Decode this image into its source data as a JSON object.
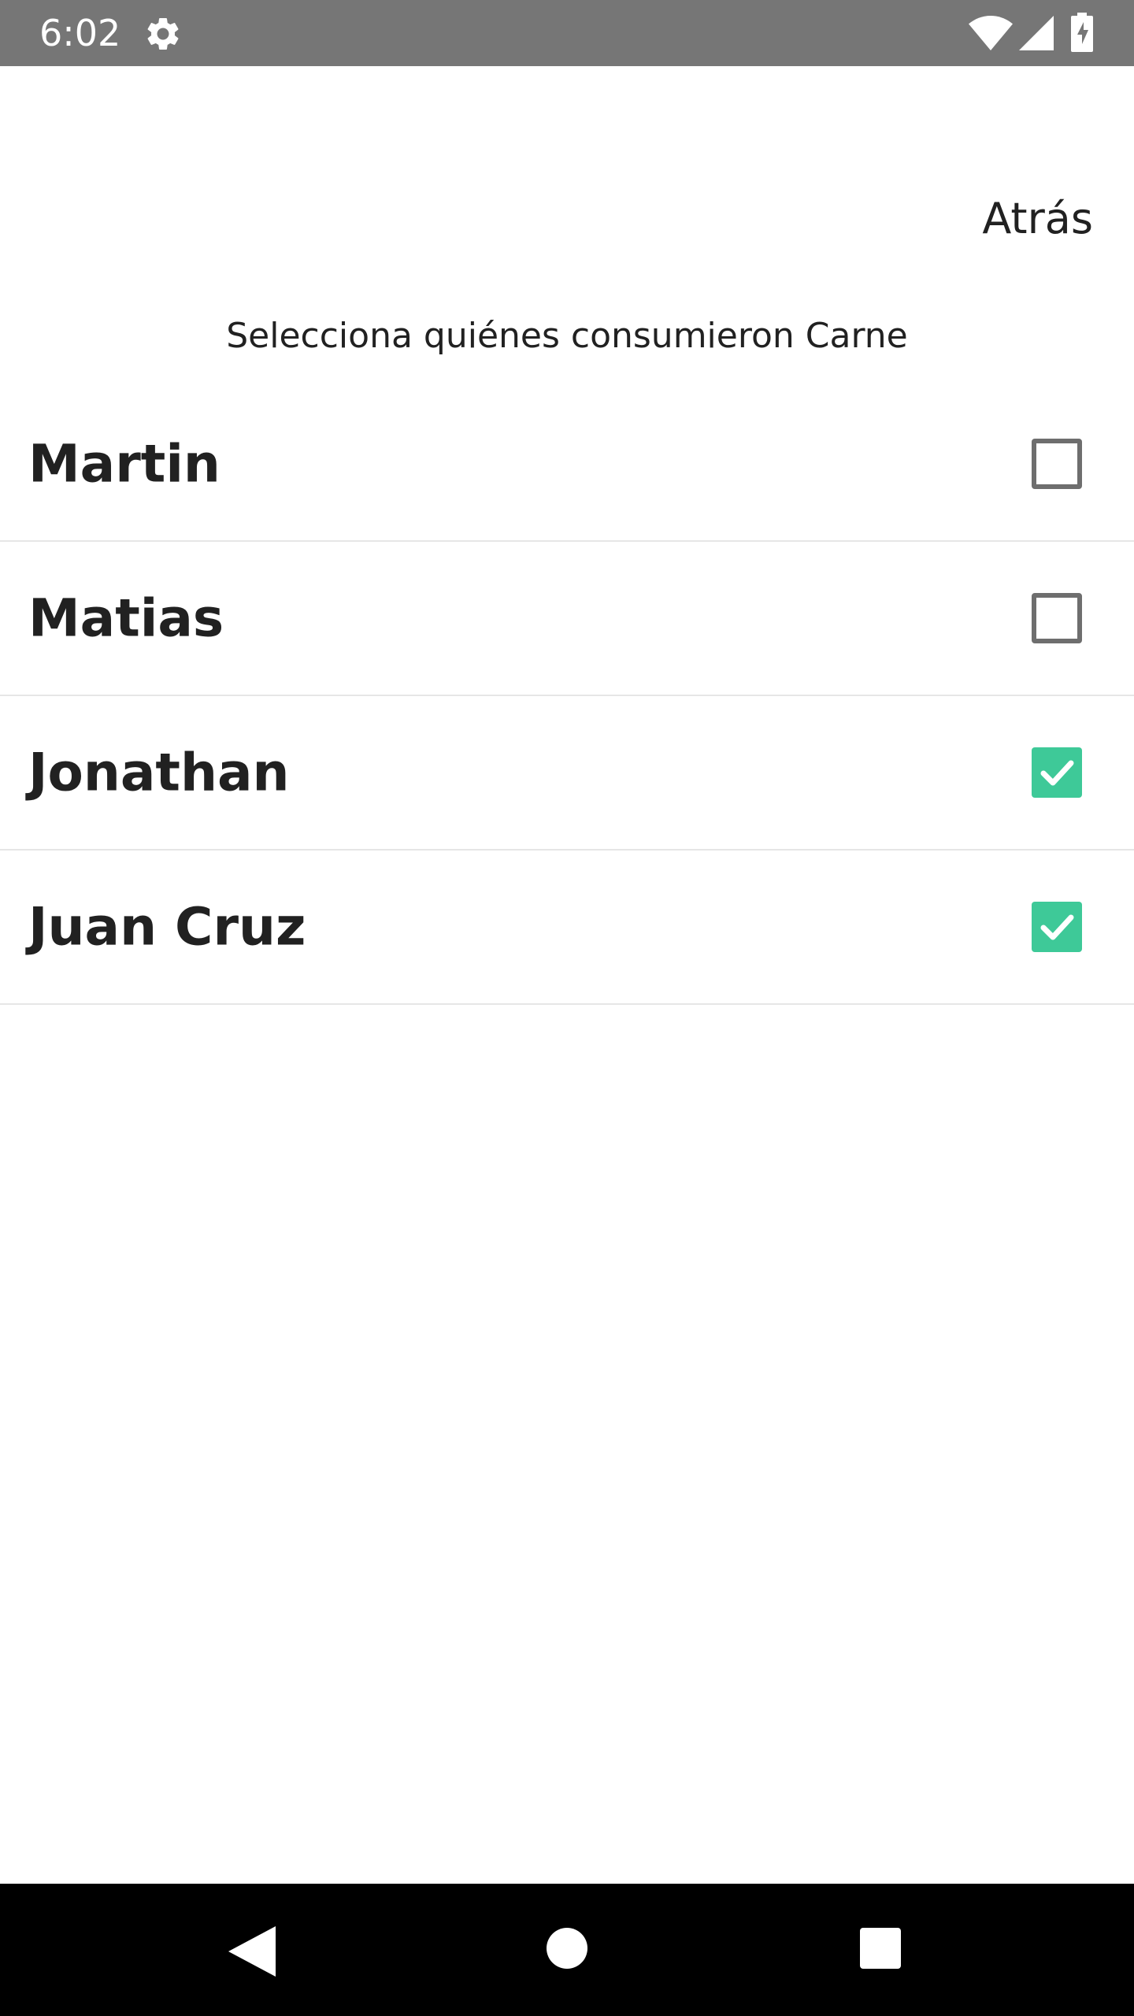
{
  "status_bar": {
    "time": "6:02",
    "background_color": "#767676",
    "icons": [
      "gear-icon",
      "wifi-icon",
      "signal-icon",
      "battery-charging-icon"
    ]
  },
  "header": {
    "back_label": "Atrás"
  },
  "instruction": "Selecciona quiénes consumieron Carne",
  "people": [
    {
      "name": "Martin",
      "checked": false
    },
    {
      "name": "Matias",
      "checked": false
    },
    {
      "name": "Jonathan",
      "checked": true
    },
    {
      "name": "Juan Cruz",
      "checked": true
    }
  ],
  "colors": {
    "checked": "#3ec998",
    "unchecked_border": "#6e6e6e",
    "divider": "#e6e6e6",
    "text": "#212121"
  },
  "nav_bar": {
    "icons": [
      "back-triangle-icon",
      "home-circle-icon",
      "recents-square-icon"
    ]
  }
}
